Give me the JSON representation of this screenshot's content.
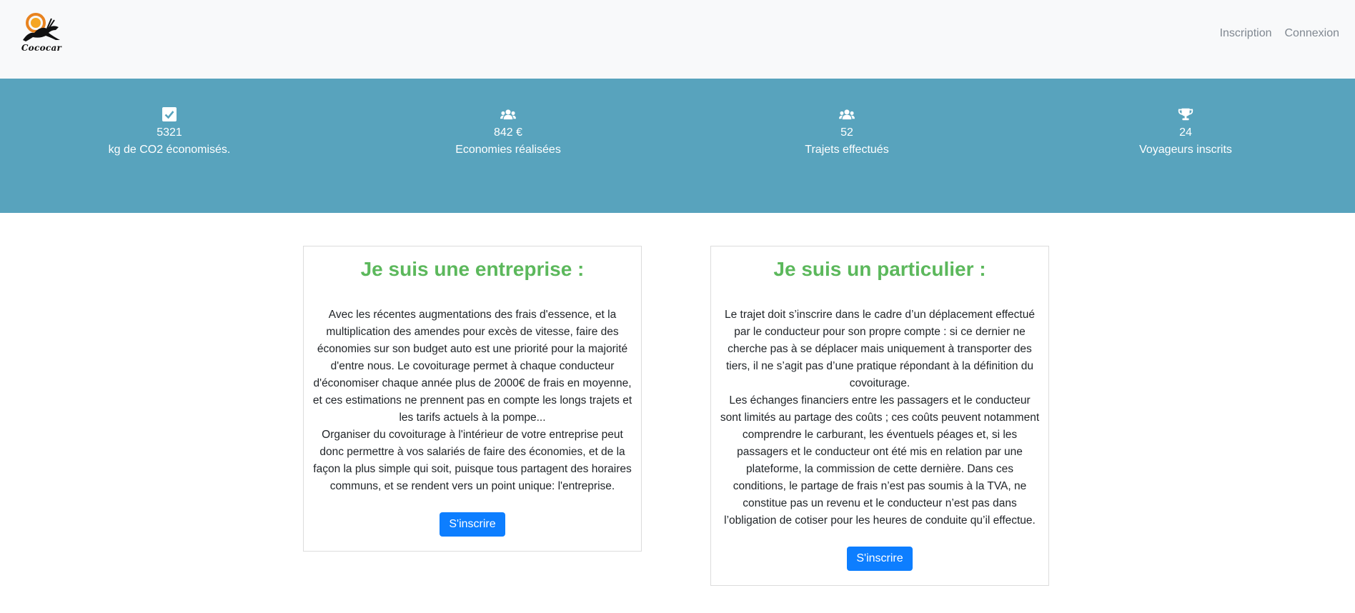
{
  "navbar": {
    "logo_text": "Cococar",
    "links": [
      "Inscription",
      "Connexion"
    ]
  },
  "stats": [
    {
      "icon": "check-square-icon",
      "value": "5321",
      "label": "kg de CO2 économisés."
    },
    {
      "icon": "users-icon",
      "value": "842 €",
      "label": "Economies réalisées"
    },
    {
      "icon": "users-icon",
      "value": "52",
      "label": "Trajets effectués"
    },
    {
      "icon": "trophy-icon",
      "value": "24",
      "label": "Voyageurs inscrits"
    }
  ],
  "cards": [
    {
      "title": "Je suis une entreprise :",
      "text": "Avec les récentes augmentations des frais d'essence, et la multiplication des amendes pour excès de vitesse, faire des économies sur son budget auto est une priorité pour la majorité d'entre nous. Le covoiturage permet à chaque conducteur d'économiser chaque année plus de 2000€ de frais en moyenne, et ces estimations ne prennent pas en compte les longs trajets et les tarifs actuels à la pompe...\nOrganiser du covoiturage à l'intérieur de votre entreprise peut donc permettre à vos salariés de faire des économies, et de la façon la plus simple qui soit, puisque tous partagent des horaires communs, et se rendent vers un point unique: l'entreprise.",
      "button": "S'inscrire"
    },
    {
      "title": "Je suis un particulier :",
      "text": "Le trajet doit s’inscrire dans le cadre d’un déplacement effectué par le conducteur pour son propre compte : si ce dernier ne cherche pas à se déplacer mais uniquement à transporter des tiers, il ne s’agit pas d’une pratique répondant à la définition du covoiturage.\nLes échanges financiers entre les passagers et le conducteur sont limités au partage des coûts ; ces coûts peuvent notamment comprendre le carburant, les éventuels péages et, si les passagers et le conducteur ont été mis en relation par une plateforme, la commission de cette dernière. Dans ces conditions, le partage de frais n’est pas soumis à la TVA, ne constitue pas un revenu et le conducteur n’est pas dans l’obligation de cotiser pour les heures de conduite qu’il effectue.",
      "button": "S'inscrire"
    }
  ],
  "colors": {
    "stats_band": "#58a3bd",
    "card_title": "#5cb85c",
    "button": "#0d7eff",
    "navbar": "#f8f9fa"
  }
}
